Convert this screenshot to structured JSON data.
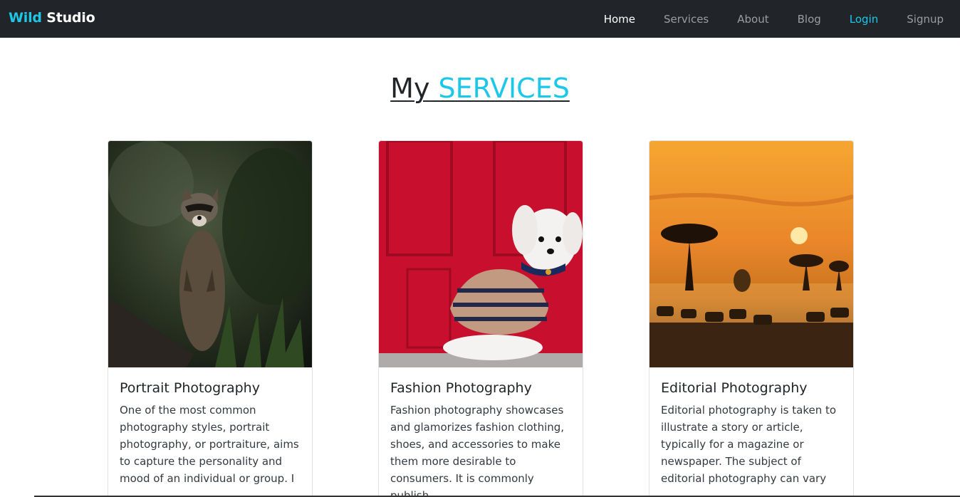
{
  "navbar": {
    "brand_part1": "Wild",
    "brand_part2": " Studio",
    "links": [
      {
        "label": "Home"
      },
      {
        "label": "Services"
      },
      {
        "label": "About"
      },
      {
        "label": "Blog"
      },
      {
        "label": "Login"
      },
      {
        "label": "Signup"
      }
    ]
  },
  "heading": {
    "part1": "My",
    "part2": " SERVICES"
  },
  "cards": [
    {
      "title": "Portrait Photography",
      "text": "One of the most common photography styles, portrait photography, or portraiture, aims to capture the personality and mood of an individual or group. I",
      "image": "raccoon-photo"
    },
    {
      "title": "Fashion Photography",
      "text": "Fashion photography showcases and glamorizes fashion clothing, shoes, and accessories to make them more desirable to consumers. It is commonly publish",
      "image": "dog-in-sweater-photo"
    },
    {
      "title": "Editorial Photography",
      "text": "Editorial photography is taken to illustrate a story or article, typically for a magazine or newspaper. The subject of editorial photography can vary",
      "image": "savanna-sunset-photo"
    }
  ],
  "colors": {
    "navbar_bg": "#212529",
    "accent": "#1cc7e8"
  }
}
